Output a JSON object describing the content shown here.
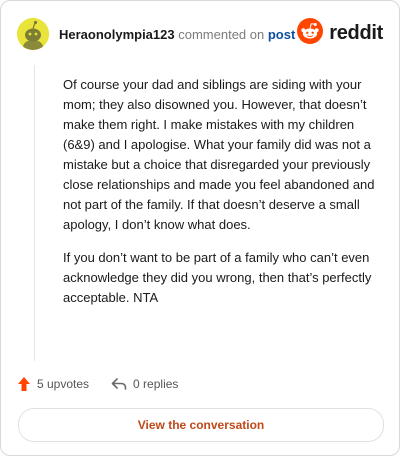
{
  "comment": {
    "author": "Heraonolympia123",
    "action_text": "commented on",
    "target_link": "post",
    "paragraphs": [
      "Of course your dad and siblings are siding with your mom; they also disowned you. However, that doesn’t make them right. I make mistakes with my children (6&9) and I apologise. What your family did was not a mistake but a choice that disregarded your previously close relationships and made you feel abandoned and not part of the family. If that doesn’t deserve a small apology, I don’t know what does.",
      "If you don’t want to be part of a family who can’t even acknowledge they did you wrong, then that’s perfectly acceptable. NTA"
    ],
    "upvotes_label": "5 upvotes",
    "replies_label": "0 replies",
    "cta_label": "View the conversation"
  },
  "brand": {
    "name": "reddit",
    "color": "#ff4500"
  },
  "colors": {
    "upvote": "#ff4500",
    "link": "#0f4f9e",
    "cta_text": "#c0491a",
    "avatar_bg": "#e8e43a"
  },
  "icons": {
    "avatar": "snoo-avatar-icon",
    "brand": "reddit-logo-icon",
    "upvote": "upvote-arrow-icon",
    "reply": "reply-arrow-icon"
  }
}
